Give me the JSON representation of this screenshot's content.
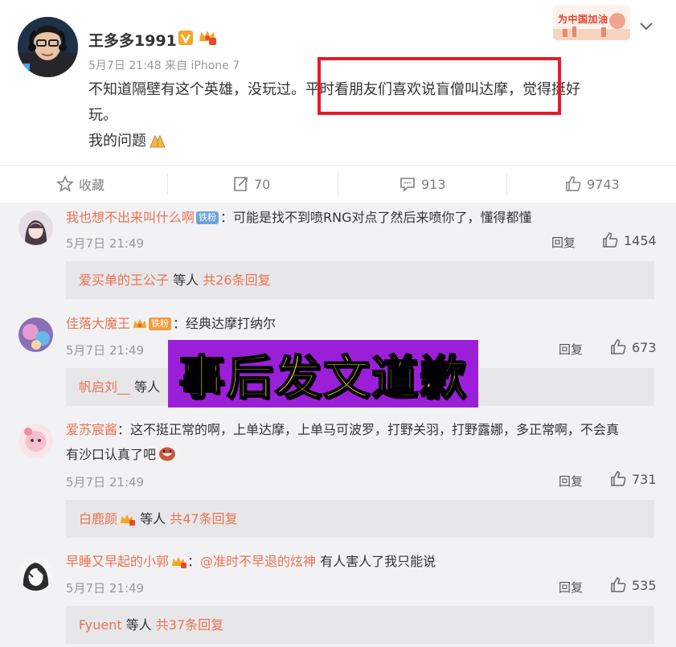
{
  "post": {
    "author": "王多多1991",
    "meta": "5月7日 21:48 来自 iPhone 7",
    "text_lines": [
      "不知道隔壁有这个英雄，没玩过。平时看朋友们喜欢说盲僧叫达摩，觉得挺好",
      "玩。",
      "我的问题"
    ],
    "promo_badge": "为中国加油",
    "highlight_color": "#e8192c"
  },
  "actions": {
    "favorite": "收藏",
    "repost": "70",
    "comment": "913",
    "like": "9743"
  },
  "comments": [
    {
      "user": "我也想不出来叫什么啊",
      "fan_badge": "铁粉",
      "text": "：可能是找不到喷RNG对点了然后来喷你了，懂得都懂",
      "time": "5月7日 21:49",
      "reply": "回复",
      "likes": "1454",
      "sub": {
        "user": "爱买单的王公子",
        "mid": " 等人 ",
        "total": "共26条回复"
      }
    },
    {
      "user": "佳落大魔王",
      "fan_badge": "铁粉",
      "text": "：经典达摩打纳尔",
      "time": "5月7日 21:49",
      "reply": "回复",
      "likes": "673",
      "sub": {
        "user": "帆启刘__",
        "mid": " 等人",
        "total": ""
      }
    },
    {
      "user": "爱苏宸酱",
      "text": "：这不挺正常的啊，上单达摩，上单马可波罗，打野关羽，打野露娜，多正常啊，不会真",
      "text2": "有沙口认真了吧",
      "time": "5月7日 21:49",
      "reply": "回复",
      "likes": "731",
      "sub": {
        "user": "白鹿颜",
        "mid": " 等人 ",
        "total": "共47条回复"
      }
    },
    {
      "user": "早睡又早起的小郭",
      "text_pre": "：",
      "mention": "@准时不早退的炫神",
      "text": " 有人害人了我只能说",
      "time": "5月7日 21:49",
      "reply": "回复",
      "likes": "535",
      "sub": {
        "user": "Fyuent",
        "mid": " 等人 ",
        "total": "共37条回复"
      }
    }
  ],
  "overlay_text": "事后发文道歉",
  "colors": {
    "username": "#eb7350",
    "overlay_bg": "#9b1fd8",
    "overlay_text": "#ffef1a"
  }
}
